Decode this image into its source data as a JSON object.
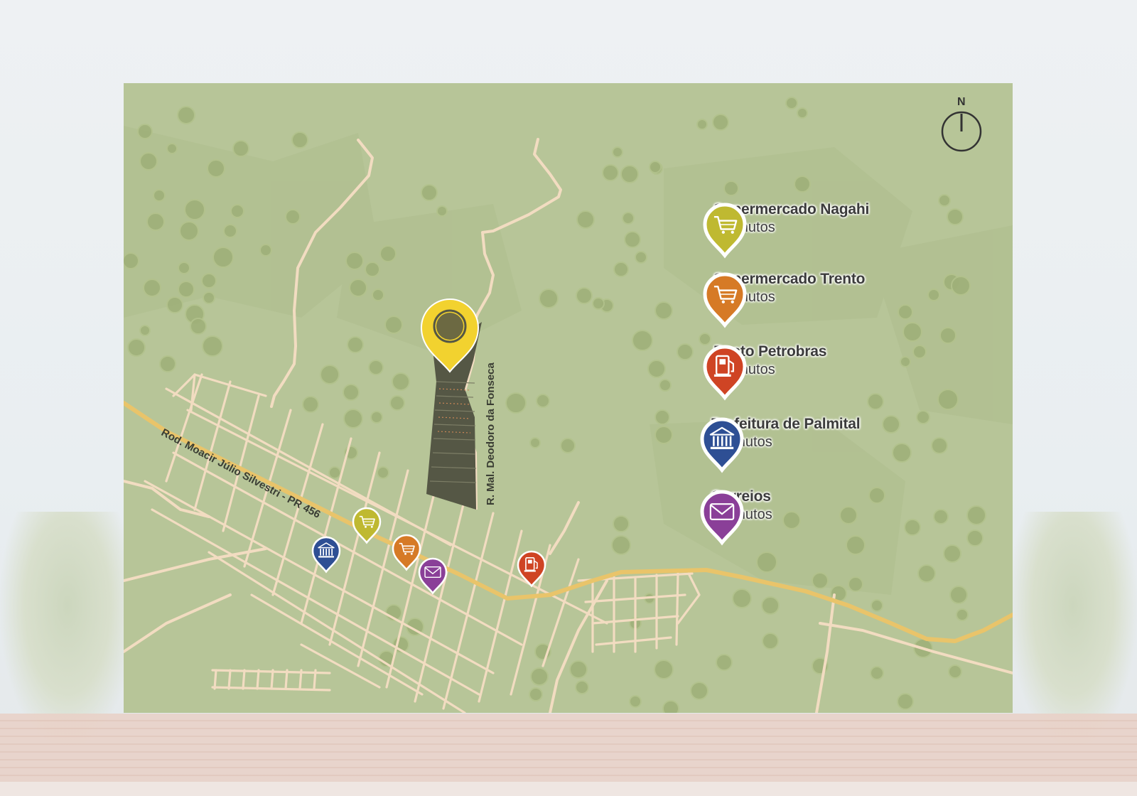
{
  "map": {
    "compass_label": "N",
    "road_labels": {
      "highway": "Rod. Moacir Júlio Silvestri - PR 456",
      "street": "R. Mal. Deodoro da Fonseca"
    },
    "legend": [
      {
        "name": "Supermercado Nagahi",
        "time": "3 minutos",
        "icon": "cart-icon",
        "color": "#bfb931"
      },
      {
        "name": "Supermercado Trento",
        "time": "3 minutos",
        "icon": "cart-icon",
        "color": "#d67a26"
      },
      {
        "name": "Posto Petrobras",
        "time": "2 minutos",
        "icon": "fuel-pump-icon",
        "color": "#cf4424"
      },
      {
        "name": "Prefeitura de Palmital",
        "time": "4 minutos",
        "icon": "bank-building-icon",
        "color": "#2e4f94"
      },
      {
        "name": "Correios",
        "time": "2 minutos",
        "icon": "envelope-icon",
        "color": "#8a3f98"
      }
    ],
    "main_marker_color": "#f2d22f"
  }
}
